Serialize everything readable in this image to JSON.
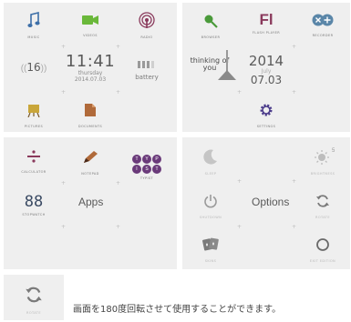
{
  "home": {
    "music": "MUSIC",
    "videos": "VIDEOS",
    "radio": "RADIO",
    "volume": "16",
    "time": "11:41",
    "weekday": "thursday",
    "date": "2014.07.03",
    "battery": "battery",
    "pictures": "PICTURES",
    "documents": "DOCUMENTS"
  },
  "browser": {
    "browser_label": "BROWSER",
    "player_logo": "Fl",
    "player_label": "FLASH PLAYER",
    "recorder_label": "RECORDER",
    "song": "thinking of\nyou",
    "year": "2014",
    "month": "July",
    "day": "07.03",
    "settings_label": "SETTINGS"
  },
  "apps": {
    "calculator": "CALCULATOR",
    "notepad": "NOTEPAD",
    "typist": "TYPIST",
    "typist_letters": [
      "T",
      "Y",
      "P",
      "I",
      "S",
      "T"
    ],
    "stopwatch_icon": "88",
    "stopwatch": "STOPWATCH",
    "center": "Apps"
  },
  "options": {
    "sleep": "SLEEP",
    "brightness": "BRIGHTNESS",
    "brightness_level": "5",
    "shutdown": "SHUTDOWN",
    "center": "Options",
    "rotate": "ROTATE",
    "skins": "SKINS",
    "exit": "EXIT EDITION"
  },
  "footer": {
    "rotate": "ROTATE",
    "text": "画面を180度回転させて使用することができます。"
  },
  "colors": {
    "music": "#3d6fa8",
    "videos": "#6ab83a",
    "radio": "#8a3a5c",
    "flash": "#8a3a5c",
    "record": "#5a86a8",
    "accent_gray": "#5b5b5b"
  }
}
